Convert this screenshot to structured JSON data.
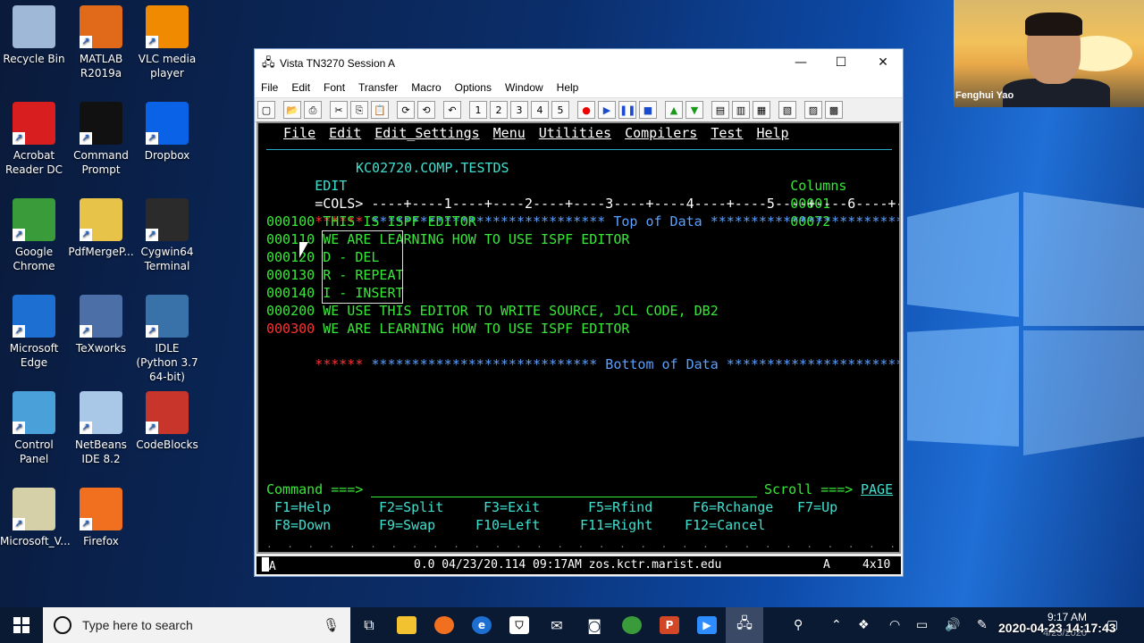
{
  "desktop": {
    "icons": [
      {
        "label": "Recycle Bin",
        "icon": "recycle-bin-icon",
        "color": "#9fb8d8"
      },
      {
        "label": "MATLAB R2019a",
        "icon": "matlab-icon",
        "color": "#e06a1a"
      },
      {
        "label": "VLC media player",
        "icon": "vlc-icon",
        "color": "#f08a00"
      },
      {
        "label": "Acrobat Reader DC",
        "icon": "acrobat-icon",
        "color": "#d81e1e"
      },
      {
        "label": "Command Prompt",
        "icon": "cmd-icon",
        "color": "#111111"
      },
      {
        "label": "Dropbox",
        "icon": "dropbox-icon",
        "color": "#0a63e6"
      },
      {
        "label": "Google Chrome",
        "icon": "chrome-icon",
        "color": "#3a9b3a"
      },
      {
        "label": "PdfMergeP...",
        "icon": "folder-icon",
        "color": "#e8c34a"
      },
      {
        "label": "Cygwin64 Terminal",
        "icon": "cygwin-icon",
        "color": "#2b2b2b"
      },
      {
        "label": "Microsoft Edge",
        "icon": "edge-icon",
        "color": "#1d6fd1"
      },
      {
        "label": "TeXworks",
        "icon": "texworks-icon",
        "color": "#4d6fa8"
      },
      {
        "label": "IDLE (Python 3.7 64-bit)",
        "icon": "python-icon",
        "color": "#3872a8"
      },
      {
        "label": "Control Panel",
        "icon": "control-panel-icon",
        "color": "#4aa0d8"
      },
      {
        "label": "NetBeans IDE 8.2",
        "icon": "netbeans-icon",
        "color": "#a9c8e8"
      },
      {
        "label": "CodeBlocks",
        "icon": "codeblocks-icon",
        "color": "#c8352a"
      },
      {
        "label": "Microsoft_V...",
        "icon": "vs-file-icon",
        "color": "#d6d0a8"
      },
      {
        "label": "Firefox",
        "icon": "firefox-icon",
        "color": "#f07020"
      }
    ]
  },
  "webcam": {
    "name": "Fenghui Yao"
  },
  "window": {
    "title": "Vista TN3270 Session A",
    "controls": {
      "minimize": "—",
      "maximize": "☐",
      "close": "✕"
    },
    "menu": [
      "File",
      "Edit",
      "Font",
      "Transfer",
      "Macro",
      "Options",
      "Window",
      "Help"
    ],
    "toolbar": [
      "new",
      "open",
      "print",
      "cut",
      "copy",
      "paste",
      "refresh",
      "refresh-2",
      "undo",
      "1",
      "2",
      "3",
      "4",
      "5",
      "record",
      "play",
      "pause",
      "stop",
      "up",
      "down",
      "tool-a",
      "tool-b",
      "tool-c",
      "tool-d",
      "tool-e",
      "tool-f"
    ]
  },
  "terminal": {
    "ispf_menu": [
      "File",
      "Edit",
      "Edit_Settings",
      "Menu",
      "Utilities",
      "Compilers",
      "Test",
      "Help"
    ],
    "header": {
      "mode": "EDIT",
      "dataset": "KC02720.COMP.TESTDS",
      "columns_label": "Columns",
      "col_from": "00001",
      "col_to": "00072"
    },
    "cols_row": {
      "label": "=COLS>",
      "ruler": " ----+----1----+----2----+----3----+----4----+----5----+----6----+----7--"
    },
    "top_row": {
      "marker": "******",
      "text": " ***************************** Top of Data ******************************"
    },
    "lines": [
      {
        "num": "000100",
        "text": " THIS IS ISPF EDITOR",
        "num_color": "green"
      },
      {
        "num": "000110",
        "text": " WE ARE LEARNING HOW TO USE ISPF EDITOR",
        "num_color": "green"
      },
      {
        "num": "000120",
        "text": " D - DEL",
        "num_color": "green"
      },
      {
        "num": "000130",
        "text": " R - REPEAT",
        "num_color": "green"
      },
      {
        "num": "000140",
        "text": " I - INSERT",
        "num_color": "green"
      },
      {
        "num": "000200",
        "text": " WE USE THIS EDITOR TO WRITE SOURCE, JCL CODE, DB2",
        "num_color": "green"
      },
      {
        "num": "000300",
        "text": " WE ARE LEARNING HOW TO USE ISPF EDITOR",
        "num_color": "red"
      }
    ],
    "bottom_row": {
      "marker": "******",
      "text": " **************************** Bottom of Data ****************************"
    },
    "command_label": "Command ===>",
    "scroll_label": "Scroll ===>",
    "scroll_value": "PAGE",
    "fkeys_row1": [
      "F1=Help",
      "F2=Split",
      "F3=Exit",
      "F5=Rfind",
      "F6=Rchange",
      "F7=Up"
    ],
    "fkeys_row2": [
      "F8=Down",
      "F9=Swap",
      "F10=Left",
      "F11=Right",
      "F12=Cancel"
    ]
  },
  "status": {
    "left": "MA",
    "info": "0.0 04/23/20.114 09:17AM zos.kctr.marist.edu",
    "mode": "A",
    "cursor": "4x10"
  },
  "taskbar": {
    "search_placeholder": "Type here to search",
    "time": "9:17 AM",
    "date": "4/23/2020",
    "overlay_timestamp": "2020-04-23 14:17:43"
  }
}
